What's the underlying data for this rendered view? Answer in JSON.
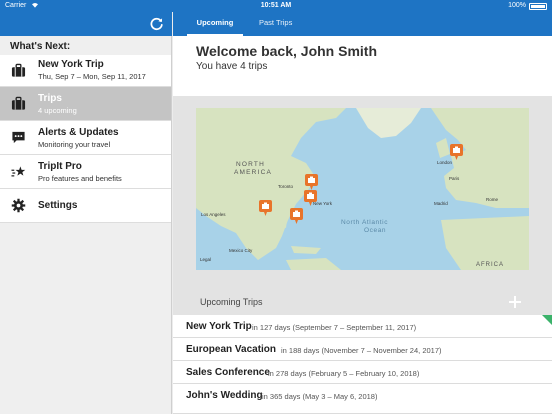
{
  "status": {
    "carrier": "Carrier",
    "time": "10:51 AM",
    "battery": "100%"
  },
  "header": {
    "tabs": [
      {
        "label": "Upcoming Trips"
      },
      {
        "label": "Past Trips"
      }
    ]
  },
  "sidebar": {
    "heading": "What's Next:",
    "items": [
      {
        "title": "New York Trip",
        "subtitle": "Thu, Sep 7 – Mon, Sep 11, 2017",
        "icon": "suitcase-icon"
      },
      {
        "title": "Trips",
        "subtitle": "4 upcoming",
        "icon": "suitcase-icon",
        "selected": true
      },
      {
        "title": "Alerts & Updates",
        "subtitle": "Monitoring your travel",
        "icon": "chat-bubble-icon"
      },
      {
        "title": "TripIt Pro",
        "subtitle": "Pro features and benefits",
        "icon": "star-icon"
      },
      {
        "title": "Settings",
        "subtitle": "",
        "icon": "gear-icon"
      }
    ]
  },
  "welcome": {
    "title": "Welcome back, John Smith",
    "subtitle": "You have 4 trips"
  },
  "map": {
    "labels": {
      "north_america": "NORTH",
      "north_america_2": "AMERICA",
      "ocean": "North Atlantic",
      "ocean_2": "Ocean",
      "africa": "AFRICA",
      "toronto": "Toronto",
      "new_york": "New York",
      "los_angeles": "Los Angeles",
      "mexico_city": "Mexico City",
      "london": "London",
      "paris": "Paris",
      "madrid": "Madrid",
      "rome": "Rome",
      "legal": "Legal"
    }
  },
  "upcoming": {
    "title": "Upcoming Trips",
    "trips": [
      {
        "name": "New York Trip",
        "detail": "in 127 days (September 7 – September 11, 2017)"
      },
      {
        "name": "European Vacation",
        "detail": "in 188 days (November 7 – November 24, 2017)"
      },
      {
        "name": "Sales Conference",
        "detail": "in 278 days (February 5 – February 10, 2018)"
      },
      {
        "name": "John's Wedding",
        "detail": "in 365 days (May 3 – May 6, 2018)"
      }
    ]
  },
  "colors": {
    "brand": "#1e74c4",
    "pin": "#e8742a",
    "flag": "#3bb26a"
  }
}
